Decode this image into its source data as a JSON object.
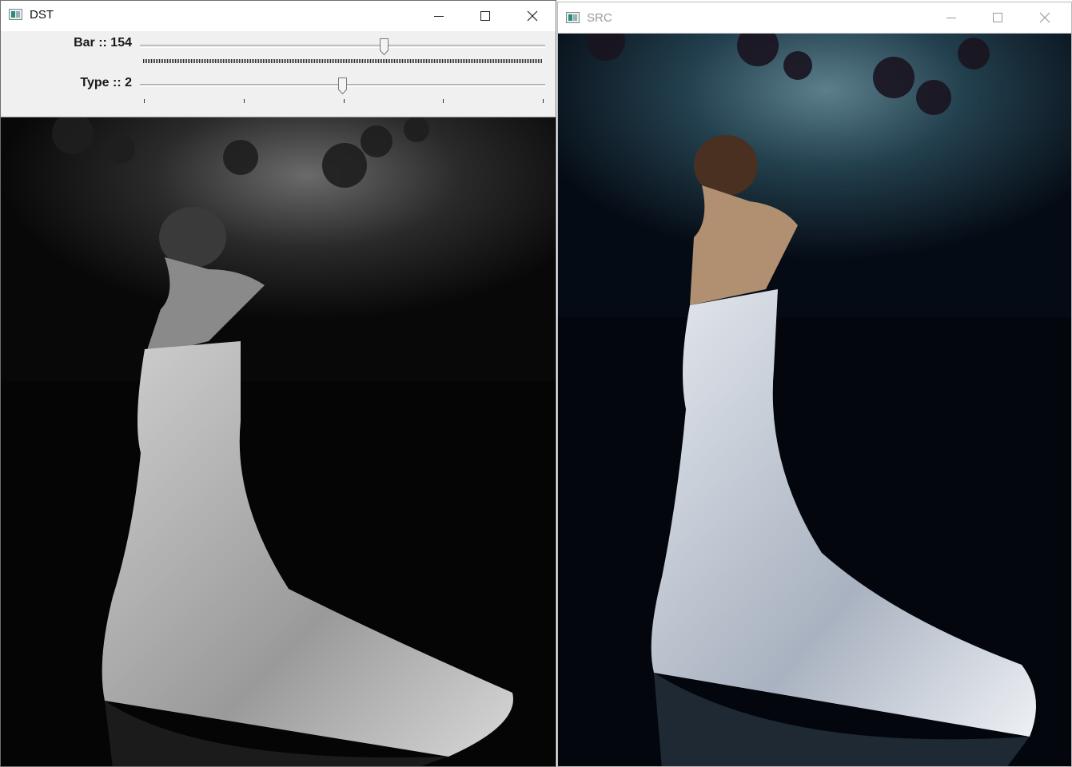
{
  "dst_window": {
    "title": "DST",
    "trackbars": [
      {
        "label": "Bar :: 154",
        "value": 154,
        "max": 255
      },
      {
        "label": "Type :: 2",
        "value": 2,
        "max": 4
      }
    ]
  },
  "src_window": {
    "title": "SRC"
  },
  "window_controls": {
    "minimize": "minimize-icon",
    "maximize": "maximize-icon",
    "close": "close-icon"
  },
  "colors": {
    "dst_background": "#050505",
    "src_background": "#0a1a24",
    "src_glow": "#4a7080"
  }
}
